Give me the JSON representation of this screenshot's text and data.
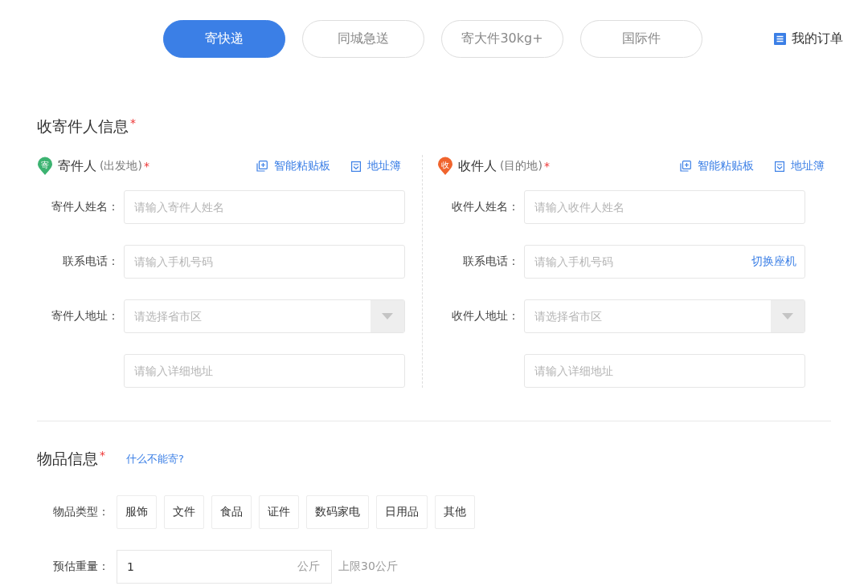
{
  "tabs": [
    {
      "label": "寄快递",
      "selected": true
    },
    {
      "label": "同城急送",
      "selected": false
    },
    {
      "label": "寄大件30kg+",
      "selected": false
    },
    {
      "label": "国际件",
      "selected": false
    }
  ],
  "my_orders": {
    "label": "我的订单"
  },
  "contact_section": {
    "title": "收寄件人信息",
    "required_mark": "*",
    "parties": [
      {
        "kind": "sender",
        "badge": "寄",
        "name": "寄件人",
        "note": "(出发地)",
        "required_mark": "*",
        "clipboard_link": "智能粘贴板",
        "addressbook_link": "地址簿",
        "fields": [
          {
            "kind": "text",
            "label": "寄件人姓名：",
            "placeholder": "请输入寄件人姓名"
          },
          {
            "kind": "text",
            "label": "联系电话：",
            "placeholder": "请输入手机号码"
          },
          {
            "kind": "select",
            "label": "寄件人地址：",
            "placeholder": "请选择省市区"
          },
          {
            "kind": "text",
            "placeholder": "请输入详细地址"
          }
        ]
      },
      {
        "kind": "receiver",
        "badge": "收",
        "name": "收件人",
        "note": "(目的地)",
        "required_mark": "*",
        "clipboard_link": "智能粘贴板",
        "addressbook_link": "地址簿",
        "fields": [
          {
            "kind": "text",
            "label": "收件人姓名：",
            "placeholder": "请输入收件人姓名"
          },
          {
            "kind": "action",
            "label": "联系电话：",
            "placeholder": "请输入手机号码",
            "action": "切换座机"
          },
          {
            "kind": "select",
            "label": "收件人地址：",
            "placeholder": "请选择省市区"
          },
          {
            "kind": "text",
            "placeholder": "请输入详细地址"
          }
        ]
      }
    ]
  },
  "item_section": {
    "title": "物品信息",
    "required_mark": "*",
    "help_link": "什么不能寄?",
    "type_label": "物品类型：",
    "types": [
      {
        "label": "服饰",
        "selected": false
      },
      {
        "label": "文件",
        "selected": false
      },
      {
        "label": "食品",
        "selected": false
      },
      {
        "label": "证件",
        "selected": false
      },
      {
        "label": "数码家电",
        "selected": false
      },
      {
        "label": "日用品",
        "selected": false
      },
      {
        "label": "其他",
        "selected": false
      }
    ],
    "weight": {
      "label": "预估重量：",
      "value": "1",
      "unit": "公斤",
      "limit": "上限30公斤"
    }
  }
}
